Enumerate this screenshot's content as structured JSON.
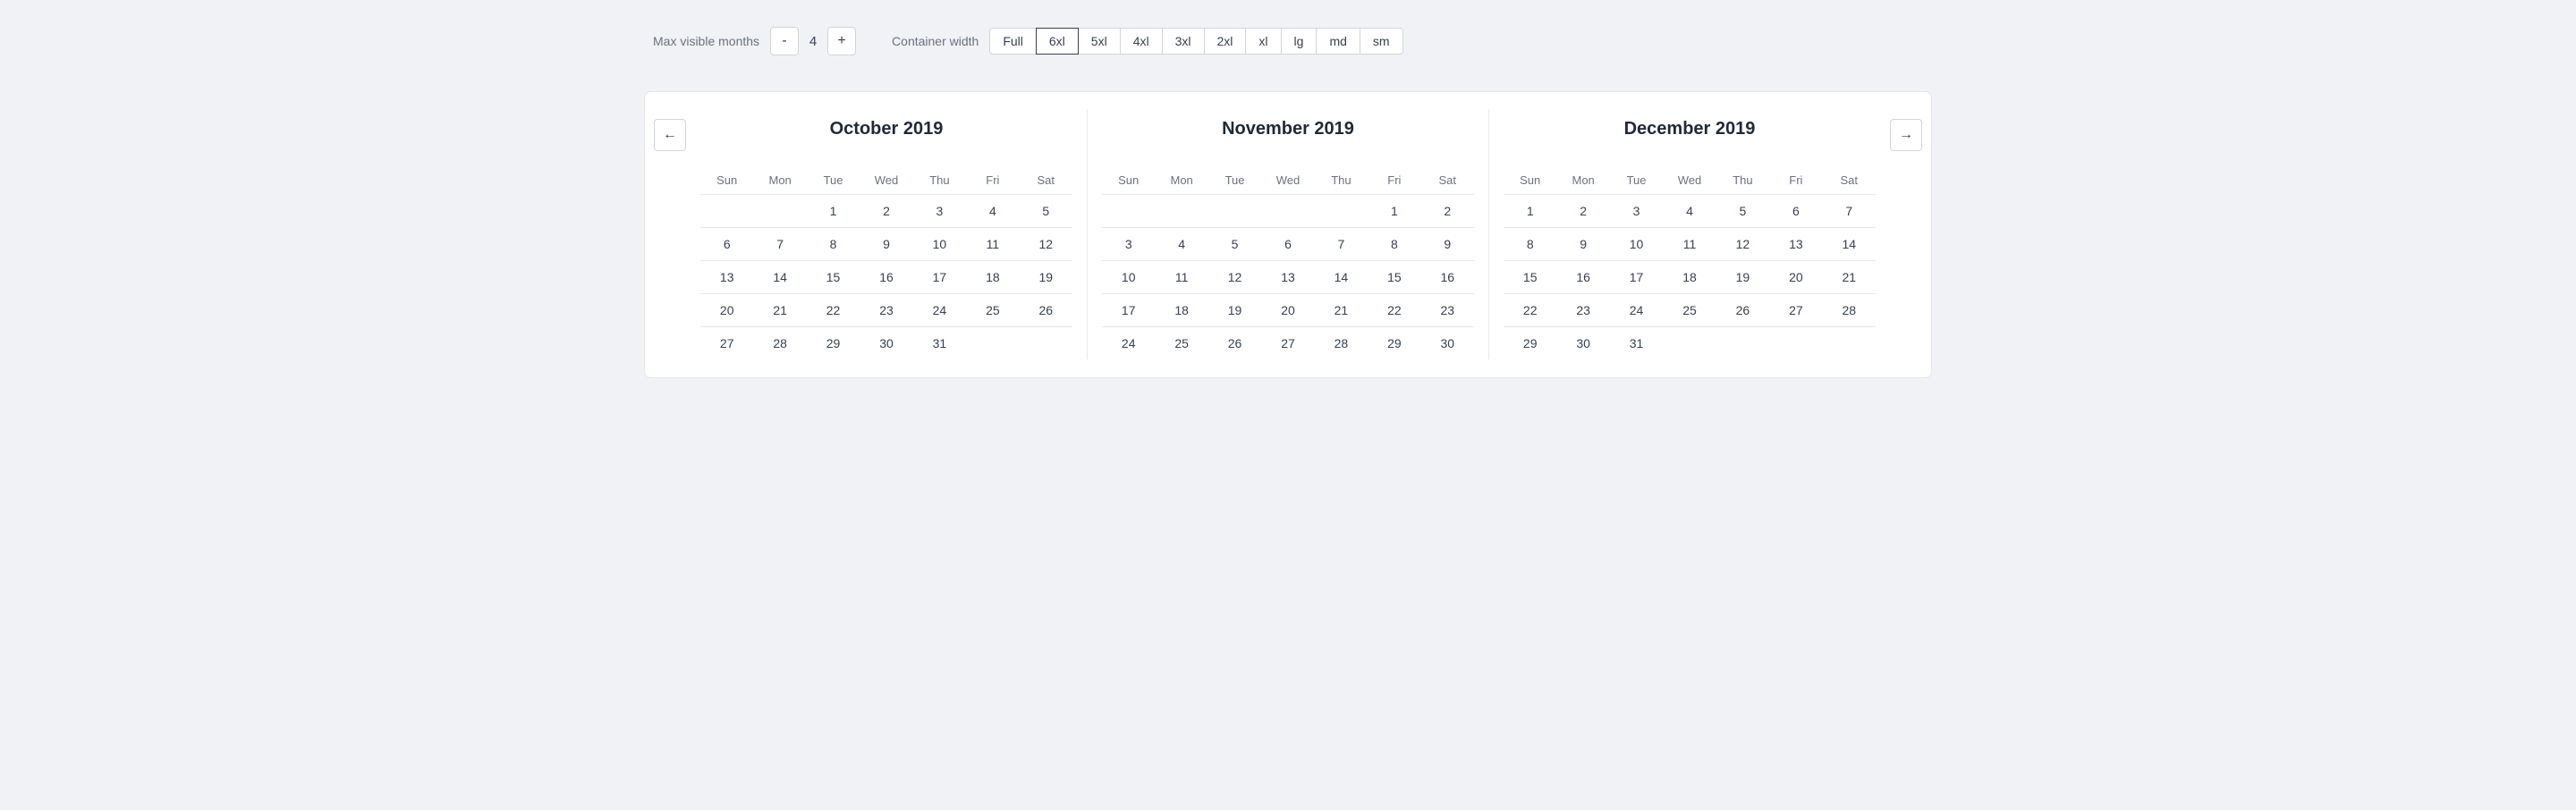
{
  "controls": {
    "max_visible_label": "Max visible months",
    "container_width_label": "Container width",
    "stepper": {
      "minus": "-",
      "value": "4",
      "plus": "+"
    },
    "width_options": [
      {
        "label": "Full",
        "active": false
      },
      {
        "label": "6xl",
        "active": true
      },
      {
        "label": "5xl",
        "active": false
      },
      {
        "label": "4xl",
        "active": false
      },
      {
        "label": "3xl",
        "active": false
      },
      {
        "label": "2xl",
        "active": false
      },
      {
        "label": "xl",
        "active": false
      },
      {
        "label": "lg",
        "active": false
      },
      {
        "label": "md",
        "active": false
      },
      {
        "label": "sm",
        "active": false
      }
    ]
  },
  "nav": {
    "prev": "←",
    "next": "→"
  },
  "months": [
    {
      "title": "October 2019",
      "days_of_week": [
        "Sun",
        "Mon",
        "Tue",
        "Wed",
        "Thu",
        "Fri",
        "Sat"
      ],
      "weeks": [
        [
          "",
          "",
          "1",
          "2",
          "3",
          "4",
          "5"
        ],
        [
          "6",
          "7",
          "8",
          "9",
          "10",
          "11",
          "12"
        ],
        [
          "13",
          "14",
          "15",
          "16",
          "17",
          "18",
          "19"
        ],
        [
          "20",
          "21",
          "22",
          "23",
          "24",
          "25",
          "26"
        ],
        [
          "27",
          "28",
          "29",
          "30",
          "31",
          "",
          ""
        ]
      ]
    },
    {
      "title": "November 2019",
      "days_of_week": [
        "Sun",
        "Mon",
        "Tue",
        "Wed",
        "Thu",
        "Fri",
        "Sat"
      ],
      "weeks": [
        [
          "",
          "",
          "",
          "",
          "",
          "1",
          "2"
        ],
        [
          "3",
          "4",
          "5",
          "6",
          "7",
          "8",
          "9"
        ],
        [
          "10",
          "11",
          "12",
          "13",
          "14",
          "15",
          "16"
        ],
        [
          "17",
          "18",
          "19",
          "20",
          "21",
          "22",
          "23"
        ],
        [
          "24",
          "25",
          "26",
          "27",
          "28",
          "29",
          "30"
        ]
      ]
    },
    {
      "title": "December 2019",
      "days_of_week": [
        "Sun",
        "Mon",
        "Tue",
        "Wed",
        "Thu",
        "Fri",
        "Sat"
      ],
      "weeks": [
        [
          "1",
          "2",
          "3",
          "4",
          "5",
          "6",
          "7"
        ],
        [
          "8",
          "9",
          "10",
          "11",
          "12",
          "13",
          "14"
        ],
        [
          "15",
          "16",
          "17",
          "18",
          "19",
          "20",
          "21"
        ],
        [
          "22",
          "23",
          "24",
          "25",
          "26",
          "27",
          "28"
        ],
        [
          "29",
          "30",
          "31",
          "",
          "",
          "",
          ""
        ]
      ]
    }
  ]
}
